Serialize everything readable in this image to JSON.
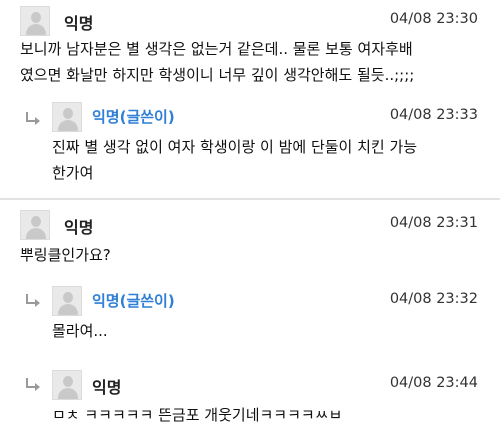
{
  "comments": [
    {
      "author": "익명",
      "time": "04/08 23:30",
      "text": "보니까 남자분은 별 생각은 없는거 같은데.. 물론 보통 여자후배\n였으면 화날만 하지만 학생이니 너무 깊이 생각안해도 될듯..;;;;",
      "avatar_icon": "default-profile-icon"
    },
    {
      "author": "익명(글쓴이)",
      "time": "04/08 23:33",
      "text": "진짜 별 생각 없이 여자 학생이랑 이 밤에 단둘이 치킨 가능\n한가여",
      "is_reply": true,
      "avatar_icon": "default-profile-icon"
    },
    {
      "author": "익명",
      "time": "04/08 23:31",
      "text": "뿌링클인가요?",
      "avatar_icon": "default-profile-icon"
    },
    {
      "author": "익명(글쓴이)",
      "time": "04/08 23:32",
      "text": "몰라여...",
      "is_reply": true,
      "avatar_icon": "default-profile-icon"
    },
    {
      "author": "익명",
      "time": "04/08 23:44",
      "text": "ㅁㅊ ㅋㅋㅋㅋㅋ 뜬금포 개웃기네ㅋㅋㅋㅋㅆㅂ",
      "is_reply": true,
      "avatar_icon": "default-profile-icon"
    }
  ],
  "colors": {
    "op_name": "#2f7fd6",
    "divider": "#e2e2e2",
    "text": "#111111"
  }
}
